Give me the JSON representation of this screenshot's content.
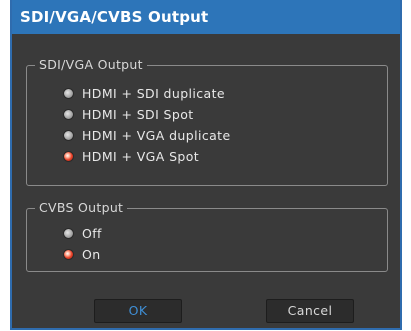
{
  "dialog": {
    "title": "SDI/VGA/CVBS Output"
  },
  "sdi_vga_group": {
    "legend": "SDI/VGA Output",
    "options": [
      {
        "label": "HDMI + SDI duplicate",
        "checked": false
      },
      {
        "label": "HDMI + SDI Spot",
        "checked": false
      },
      {
        "label": "HDMI + VGA duplicate",
        "checked": false
      },
      {
        "label": "HDMI + VGA Spot",
        "checked": true
      }
    ]
  },
  "cvbs_group": {
    "legend": "CVBS Output",
    "options": [
      {
        "label": "Off",
        "checked": false
      },
      {
        "label": "On",
        "checked": true
      }
    ]
  },
  "buttons": {
    "ok_label": "OK",
    "cancel_label": "Cancel"
  },
  "colors": {
    "title_bar": "#2d75b9",
    "dialog_bg": "#3a3a3a",
    "selected_radio": "#e8422a",
    "ok_text": "#3f8fd6"
  }
}
